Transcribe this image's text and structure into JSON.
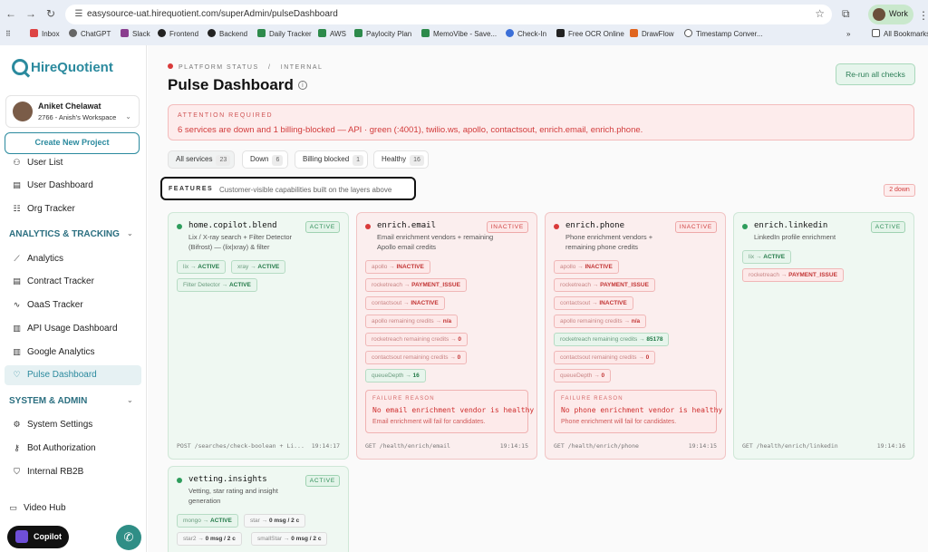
{
  "browser": {
    "url": "easysource-uat.hirequotient.com/superAdmin/pulseDashboard",
    "profile": "Work",
    "bookmarks": [
      "Inbox",
      "ChatGPT",
      "Slack",
      "Frontend",
      "Backend",
      "Daily Tracker",
      "AWS",
      "Paylocity Plan",
      "MemoVibe - Save...",
      "Check-In",
      "Free OCR Online",
      "DrawFlow",
      "Timestamp Conver...",
      "All Bookmarks"
    ]
  },
  "sidebar": {
    "brand": "HireQuotient",
    "user_name": "Aniket Chelawat",
    "workspace": "2766 - Anish's Workspace",
    "create_label": "Create New Project",
    "items_top": [
      {
        "label": "User List",
        "icon": "user-list-icon",
        "glyph": "⚇"
      },
      {
        "label": "User Dashboard",
        "icon": "dashboard-icon",
        "glyph": "▤"
      },
      {
        "label": "Org Tracker",
        "icon": "org-tracker-icon",
        "glyph": "☷"
      }
    ],
    "section1": "ANALYTICS & TRACKING",
    "items_analytics": [
      {
        "label": "Analytics",
        "icon": "analytics-icon",
        "glyph": "⟋"
      },
      {
        "label": "Contract Tracker",
        "icon": "contract-icon",
        "glyph": "▤"
      },
      {
        "label": "OaaS Tracker",
        "icon": "pulse-icon",
        "glyph": "∿"
      },
      {
        "label": "API Usage Dashboard",
        "icon": "bar-chart-icon",
        "glyph": "▥"
      },
      {
        "label": "Google Analytics",
        "icon": "bar-chart-icon",
        "glyph": "▥"
      },
      {
        "label": "Pulse Dashboard",
        "icon": "heartbeat-icon",
        "glyph": "♡"
      }
    ],
    "section2": "SYSTEM & ADMIN",
    "items_system": [
      {
        "label": "System Settings",
        "icon": "gear-icon",
        "glyph": "⚙"
      },
      {
        "label": "Bot Authorization",
        "icon": "key-icon",
        "glyph": "⚷"
      },
      {
        "label": "Internal RB2B",
        "icon": "shield-icon",
        "glyph": "⛉"
      }
    ],
    "video_hub": "Video Hub",
    "copilot": "Copilot"
  },
  "header": {
    "crumb_status": "PLATFORM STATUS",
    "crumb_sep": "/",
    "crumb_internal": "INTERNAL",
    "title": "Pulse Dashboard",
    "rerun": "Re-run all checks"
  },
  "alert": {
    "kicker": "ATTENTION REQUIRED",
    "message": "6 services are down and 1 billing-blocked — API · green (:4001), twilio.ws, apollo, contactsout, enrich.email, enrich.phone."
  },
  "filters": [
    {
      "label": "All services",
      "count": "23"
    },
    {
      "label": "Down",
      "count": "6"
    },
    {
      "label": "Billing blocked",
      "count": "1"
    },
    {
      "label": "Healthy",
      "count": "16"
    }
  ],
  "features": {
    "kicker": "FEATURES",
    "description": "Customer-visible capabilities built on the layers above",
    "down_badge": "2 down"
  },
  "cards": [
    {
      "name": "home.copilot.blend",
      "status": "ACTIVE",
      "ok": true,
      "desc": "Lix / X-ray search + Filter Detector (Bifrost) — (lix|xray) & filter",
      "tags": [
        {
          "k": "lix",
          "v": "ACTIVE",
          "ok": true
        },
        {
          "k": "xray",
          "v": "ACTIVE",
          "ok": true
        },
        {
          "k": "Filter Detector",
          "v": "ACTIVE",
          "ok": true
        }
      ],
      "endpoint": "POST /searches/check-boolean + Li...",
      "time": "19:14:17"
    },
    {
      "name": "enrich.email",
      "status": "INACTIVE",
      "ok": false,
      "desc": "Email enrichment vendors + remaining Apollo email credits",
      "tags": [
        {
          "k": "apollo",
          "v": "INACTIVE",
          "ok": false
        },
        {
          "k": "rocketreach",
          "v": "PAYMENT_ISSUE",
          "ok": false
        },
        {
          "k": "contactsout",
          "v": "INACTIVE",
          "ok": false
        },
        {
          "k": "apollo remaining credits",
          "v": "n/a",
          "ok": false
        },
        {
          "k": "rocketreach remaining credits",
          "v": "0",
          "ok": false
        },
        {
          "k": "contactsout remaining credits",
          "v": "0",
          "ok": false
        },
        {
          "k": "queueDepth",
          "v": "16",
          "ok": true
        }
      ],
      "fail_kicker": "FAILURE REASON",
      "fail_head": "No email enrichment vendor is healthy",
      "fail_sub": "Email enrichment will fail for candidates.",
      "endpoint": "GET /health/enrich/email",
      "time": "19:14:15"
    },
    {
      "name": "enrich.phone",
      "status": "INACTIVE",
      "ok": false,
      "desc": "Phone enrichment vendors + remaining phone credits",
      "tags": [
        {
          "k": "apollo",
          "v": "INACTIVE",
          "ok": false
        },
        {
          "k": "rocketreach",
          "v": "PAYMENT_ISSUE",
          "ok": false
        },
        {
          "k": "contactsout",
          "v": "INACTIVE",
          "ok": false
        },
        {
          "k": "apollo remaining credits",
          "v": "n/a",
          "ok": false
        },
        {
          "k": "rocketreach remaining credits",
          "v": "85178",
          "ok": true
        },
        {
          "k": "contactsout remaining credits",
          "v": "0",
          "ok": false
        },
        {
          "k": "queueDepth",
          "v": "0",
          "ok": false
        }
      ],
      "fail_kicker": "FAILURE REASON",
      "fail_head": "No phone enrichment vendor is healthy",
      "fail_sub": "Phone enrichment will fail for candidates.",
      "endpoint": "GET /health/enrich/phone",
      "time": "19:14:15"
    },
    {
      "name": "enrich.linkedin",
      "status": "ACTIVE",
      "ok": true,
      "desc": "LinkedIn profile enrichment",
      "tags": [
        {
          "k": "lix",
          "v": "ACTIVE",
          "ok": true
        },
        {
          "k": "rocketreach",
          "v": "PAYMENT_ISSUE",
          "ok": false
        }
      ],
      "endpoint": "GET /health/enrich/linkedin",
      "time": "19:14:16"
    },
    {
      "name": "vetting.insights",
      "status": "ACTIVE",
      "ok": true,
      "desc": "Vetting, star rating and insight generation",
      "tags": [
        {
          "k": "mongo",
          "v": "ACTIVE",
          "ok": true
        },
        {
          "k": "star",
          "v": "0 msg / 2 c",
          "ok": null
        },
        {
          "k": "star2",
          "v": "0 msg / 2 c",
          "ok": null
        },
        {
          "k": "smallStar",
          "v": "0 msg / 2 c",
          "ok": null
        }
      ]
    }
  ]
}
